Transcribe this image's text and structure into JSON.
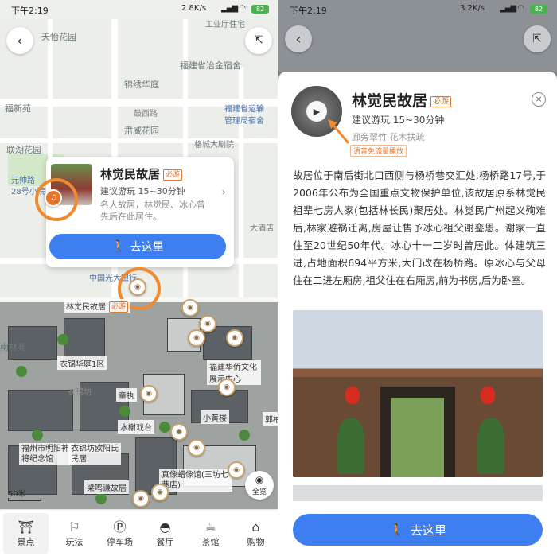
{
  "status_bar": {
    "left": {
      "time": "下午2:19",
      "net": "2.8K/s",
      "battery": "82"
    },
    "right": {
      "time": "下午2:19",
      "net": "3.2K/s",
      "battery": "82"
    }
  },
  "map": {
    "labels": [
      "天怡花园",
      "工业厅住宅",
      "福建省冶金宿舍",
      "锦绣华庭",
      "福新苑",
      "鼓西路",
      "福建省运输管理局宿舍",
      "肃威花园",
      "联湖花园",
      "格城大剧院",
      "元帅路",
      "28号小院",
      "大酒店",
      "中国光大银行",
      "林觉民故居",
      "南林苑",
      "衣锦华庭1区",
      "福建华侨文化展示中心",
      "童执",
      "小黄楼",
      "水榭戏台",
      "福州市明阳神将纪念馆",
      "衣锦坊欧阳氏民居",
      "真像蜡像馆(三坊七巷店)",
      "梁鸣谦故居",
      "郭柏"
    ],
    "road_labels": [
      "鼓西路",
      "元帅路",
      "杨桥路",
      "衣锦坊",
      "吉庇路"
    ],
    "scale_label": "50米",
    "overview_label": "全览",
    "poi_card": {
      "title": "林觉民故居",
      "badge": "必游",
      "duration": "建议游玩 15~30分钟",
      "description": "名人故居，林觉民、冰心曾先后在此居住。",
      "go_button": "去这里"
    },
    "map_poi_label": "林觉民故居",
    "map_poi_badge": "必游"
  },
  "tabs": [
    {
      "label": "景点",
      "icon": "scenic-icon",
      "active": true
    },
    {
      "label": "玩法",
      "icon": "route-icon",
      "active": false
    },
    {
      "label": "停车场",
      "icon": "parking-icon",
      "active": false
    },
    {
      "label": "餐厅",
      "icon": "restaurant-icon",
      "active": false
    },
    {
      "label": "茶馆",
      "icon": "teapot-icon",
      "active": false
    },
    {
      "label": "购物",
      "icon": "shopping-icon",
      "active": false
    }
  ],
  "detail": {
    "title": "林觉民故居",
    "badge": "必游",
    "duration": "建议游玩 15~30分钟",
    "tags": "廊旁翠竹  花木扶疏",
    "audio_label": "语音免流量播放",
    "body": "故居位于南后街北口西侧与杨桥巷交汇处,杨桥路17号,于2006年公布为全国重点文物保护单位,该故居原系林觉民祖辈七房人家(包括林长民)聚居处。林觉民广州起义殉难后,林家避祸迁离,房屋让售予冰心祖父谢銮恩。谢家一直住至20世纪50年代。冰心十一二岁时曾居此。体建筑三进,占地面积694平方米,大门改在杨桥路。原冰心与父母住在二进左厢房,祖父住在右厢房,前为书房,后为卧室。",
    "go_button": "去这里"
  },
  "colors": {
    "accent": "#3d7ef0",
    "highlight": "#f08a2e",
    "badge": "#e8742a"
  }
}
